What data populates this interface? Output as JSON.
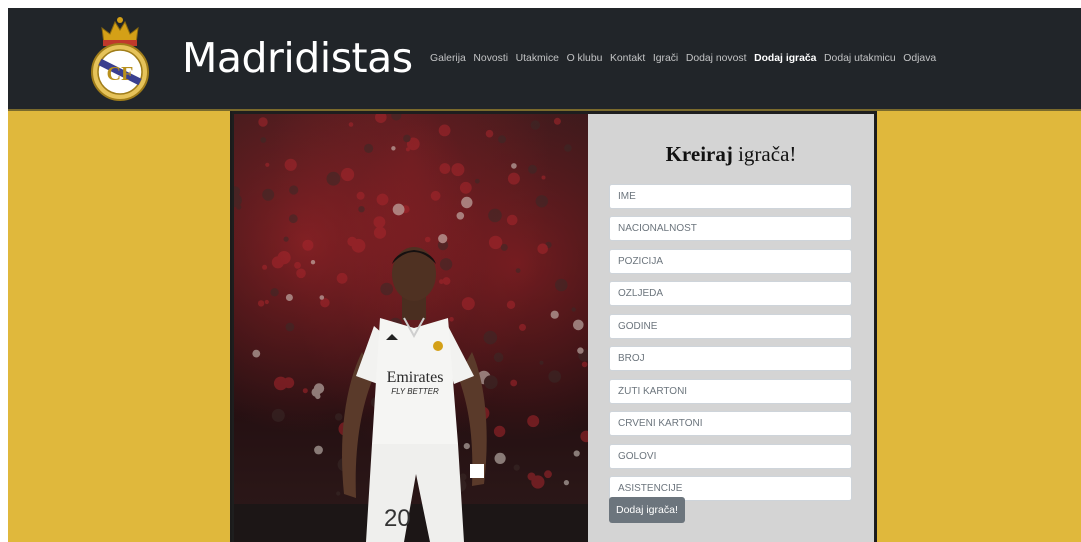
{
  "brand": {
    "title": "Madridistas"
  },
  "nav": {
    "items": [
      {
        "label": "Galerija"
      },
      {
        "label": "Novosti"
      },
      {
        "label": "Utakmice"
      },
      {
        "label": "O klubu"
      },
      {
        "label": "Kontakt"
      },
      {
        "label": "Igrači"
      },
      {
        "label": "Dodaj novost"
      },
      {
        "label": "Dodaj igrača"
      },
      {
        "label": "Dodaj utakmicu"
      },
      {
        "label": "Odjava"
      }
    ],
    "active": "Dodaj igrača"
  },
  "photo": {
    "sponsor": "Emirates",
    "sponsor_tagline": "FLY BETTER",
    "shirt_number": "20"
  },
  "form": {
    "title_bold": "Kreiraj",
    "title_rest": " igrača!",
    "fields": [
      {
        "placeholder": "IME"
      },
      {
        "placeholder": "NACIONALNOST"
      },
      {
        "placeholder": "POZICIJA"
      },
      {
        "placeholder": "OZLJEDA"
      },
      {
        "placeholder": "GODINE"
      },
      {
        "placeholder": "BROJ"
      },
      {
        "placeholder": "ŽUTI KARTONI"
      },
      {
        "placeholder": "CRVENI KARTONI"
      },
      {
        "placeholder": "GOLOVI"
      },
      {
        "placeholder": "ASISTENCIJE"
      }
    ],
    "submit_label": "Dodaj igrača!"
  },
  "colors": {
    "navbar": "#212529",
    "page_background": "#e0b83c",
    "form_panel": "#d4d4d4",
    "button": "#6c757d"
  }
}
